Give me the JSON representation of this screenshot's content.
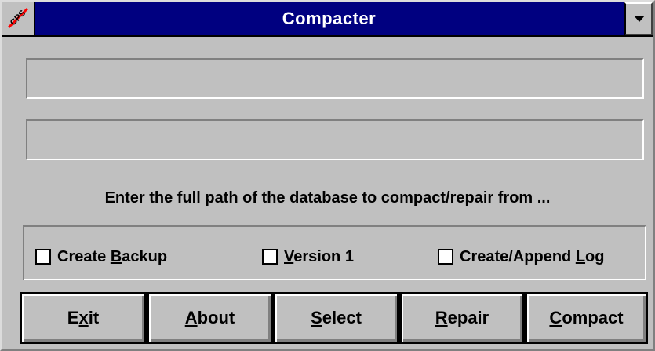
{
  "window": {
    "title": "Compacter",
    "sysmenu_label": "CPS",
    "title_bg": "#000080",
    "face": "#c0c0c0"
  },
  "fields": {
    "source_value": "",
    "target_value": ""
  },
  "instruction": "Enter the full path of the database to compact/repair from ...",
  "options": [
    {
      "pre": "Create ",
      "hot": "B",
      "post": "ackup",
      "checked": false
    },
    {
      "pre": "",
      "hot": "V",
      "post": "ersion 1",
      "checked": false
    },
    {
      "pre": "Create/Append ",
      "hot": "L",
      "post": "og",
      "checked": false
    }
  ],
  "buttons": [
    {
      "pre": "E",
      "hot": "x",
      "post": "it"
    },
    {
      "pre": "",
      "hot": "A",
      "post": "bout"
    },
    {
      "pre": "",
      "hot": "S",
      "post": "elect"
    },
    {
      "pre": "",
      "hot": "R",
      "post": "epair"
    },
    {
      "pre": "",
      "hot": "C",
      "post": "ompact"
    }
  ],
  "icons": {
    "sysmenu": "cps-app-icon",
    "dropdown": "chevron-down-icon",
    "checkbox": "checkbox-icon"
  }
}
